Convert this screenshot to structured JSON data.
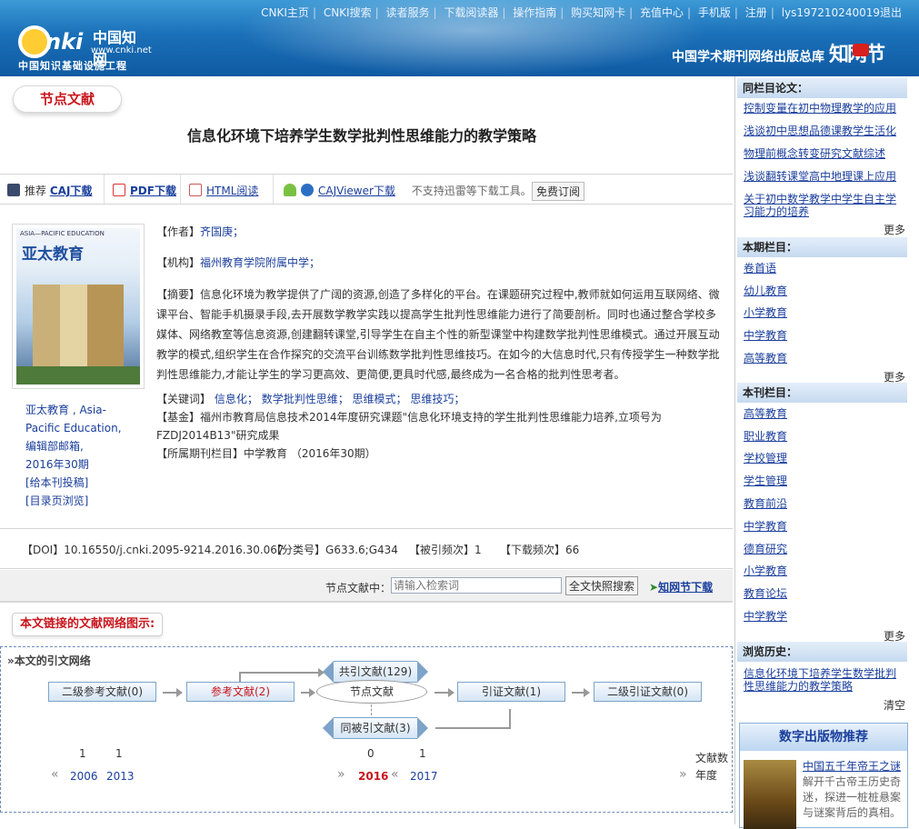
{
  "topnav": [
    "CNKI主页",
    "CNKI搜索",
    "读者服务",
    "下载阅读器",
    "操作指南",
    "购买知网卡",
    "充值中心",
    "手机版",
    "注册",
    "lys197210240019退出"
  ],
  "logo": {
    "brand_en": "nki",
    "brand_cn": "中国知网",
    "url": "www.cnki.net",
    "sub": "中国知识基础设施工程"
  },
  "header_slogan": "中国学术期刊网络出版总库",
  "header_brand": "知网节",
  "tag": "节点文献",
  "title": "信息化环境下培养学生数学批判性思维能力的教学策略",
  "toolbar": {
    "recommend": "推荐",
    "caj": "CAJ下载",
    "pdf": "PDF下载",
    "html": "HTML阅读",
    "cajviewer": "CAJViewer下载",
    "note": "不支持迅雷等下载工具。",
    "free": "免费订阅"
  },
  "cover": {
    "top": "ASIA—PACIFIC EDUCATION",
    "name": "亚太教育"
  },
  "journal": {
    "line1": "亚太教育 , Asia-",
    "line2": "Pacific Education,",
    "line3": "编辑部邮箱,",
    "line4": "2016年30期",
    "link1": "[给本刊投稿]",
    "link2": "[目录页浏览]"
  },
  "fields": {
    "author_label": "【作者】",
    "author": "齐国庚；",
    "org_label": "【机构】",
    "org": "福州教育学院附属中学；",
    "abstract_label": "【摘要】",
    "abstract": "信息化环境为教学提供了广阔的资源,创造了多样化的平台。在课题研究过程中,教师就如何运用互联网络、微课平台、智能手机摄录手段,去开展数学教学实践以提高学生批判性思维能力进行了简要剖析。同时也通过整合学校多媒体、网络教室等信息资源,创建翻转课堂,引导学生在自主个性的新型课堂中构建数学批判性思维模式。通过开展互动教学的模式,组织学生在合作探究的交流平台训练数学批判性思维技巧。在如今的大信息时代,只有传授学生一种数学批判性思维能力,才能让学生的学习更高效、更简便,更具时代感,最终成为一名合格的批判性思考者。",
    "kw_label": "【关键词】",
    "keywords": [
      "信息化；",
      "数学批判性思维；",
      "思维模式；",
      "思维技巧；"
    ],
    "fund_label": "【基金】",
    "fund": "福州市教育局信息技术2014年度研究课题\"信息化环境支持的学生批判性思维能力培养,立项号为FZDJ2014B13\"研究成果",
    "col_label": "【所属期刊栏目】",
    "col": "中学教育 （2016年30期）"
  },
  "doi": {
    "doi_label": "【DOI】",
    "doi": "10.16550/j.cnki.2095-9214.2016.30.067",
    "cls_label": "【分类号】",
    "cls": "G633.6;G434",
    "cite_label": "【被引频次】",
    "cite": "1",
    "dl_label": "【下载频次】",
    "dl": "66"
  },
  "search": {
    "label": "节点文献中：",
    "placeholder": "请输入检索词",
    "fulltext_btn": "全文快照搜索",
    "knode": "知网节下载"
  },
  "network": {
    "btn": "本文链接的文献网络图示:",
    "heading": "»本文的引文网络",
    "nodes": {
      "second_ref": "二级参考文献(0)",
      "ref": "参考文献(2)",
      "node": "节点文献",
      "cite": "引证文献(1)",
      "second_cite": "二级引证文献(0)",
      "co_cite": "共引文献(129)",
      "co_cited": "同被引文献(3)"
    },
    "years_left": [
      {
        "count": "1",
        "year": "2006"
      },
      {
        "count": "1",
        "year": "2013"
      }
    ],
    "years_right": [
      {
        "count": "0",
        "year": "2016"
      },
      {
        "count": "1",
        "year": "2017"
      }
    ],
    "legend_count": "文献数",
    "legend_year": "年度"
  },
  "sidebar": {
    "same_col_title": "同栏目论文：",
    "same_col": [
      "控制变量在初中物理教学的应用",
      "浅谈初中思想品德课教学生活化",
      "物理前概念转变研究文献综述",
      "浅谈翻转课堂高中地理课上应用",
      "关于初中数学教学中学生自主学习能力的培养"
    ],
    "issue_title": "本期栏目：",
    "issue": [
      "卷首语",
      "幼儿教育",
      "小学教育",
      "中学教育",
      "高等教育"
    ],
    "journal_title": "本刊栏目：",
    "journal": [
      "高等教育",
      "职业教育",
      "学校管理",
      "学生管理",
      "教育前沿",
      "中学教育",
      "德育研究",
      "小学教育",
      "教育论坛",
      "中学教学"
    ],
    "more": "更多",
    "history_title": "浏览历史：",
    "history": "信息化环境下培养学生数学批判性思维能力的教学策略",
    "clear": "清空",
    "rec_title": "数字出版物推荐",
    "rec_book": "中国五千年帝王之谜",
    "rec_desc": "解开千古帝王历史奇迷，探进一桩桩悬案与谜案背后的真相。"
  },
  "colors": {
    "header_blue": "#1a70b8",
    "link": "#1a3e9c",
    "accent_red": "#c8161d"
  }
}
